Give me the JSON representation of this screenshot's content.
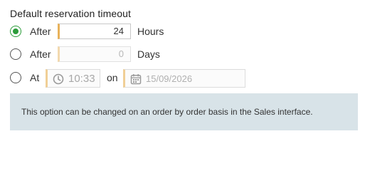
{
  "section": {
    "heading": "Default reservation timeout"
  },
  "options": [
    {
      "label": "After",
      "value": "24",
      "unit": "Hours",
      "selected": true
    },
    {
      "label": "After",
      "value": "0",
      "unit": "Days",
      "selected": false
    }
  ],
  "at_option": {
    "label": "At",
    "time": "10:33",
    "on_label": "on",
    "date": "15/09/2026",
    "selected": false
  },
  "info": {
    "text": "This option can be changed on an order by order basis in the Sales interface."
  },
  "colors": {
    "accent_green": "#2b9c3a",
    "input_left_border": "#e8b25a",
    "info_background": "#d8e3e8"
  },
  "icons": {
    "time": "clock-icon",
    "date": "calendar-icon"
  }
}
